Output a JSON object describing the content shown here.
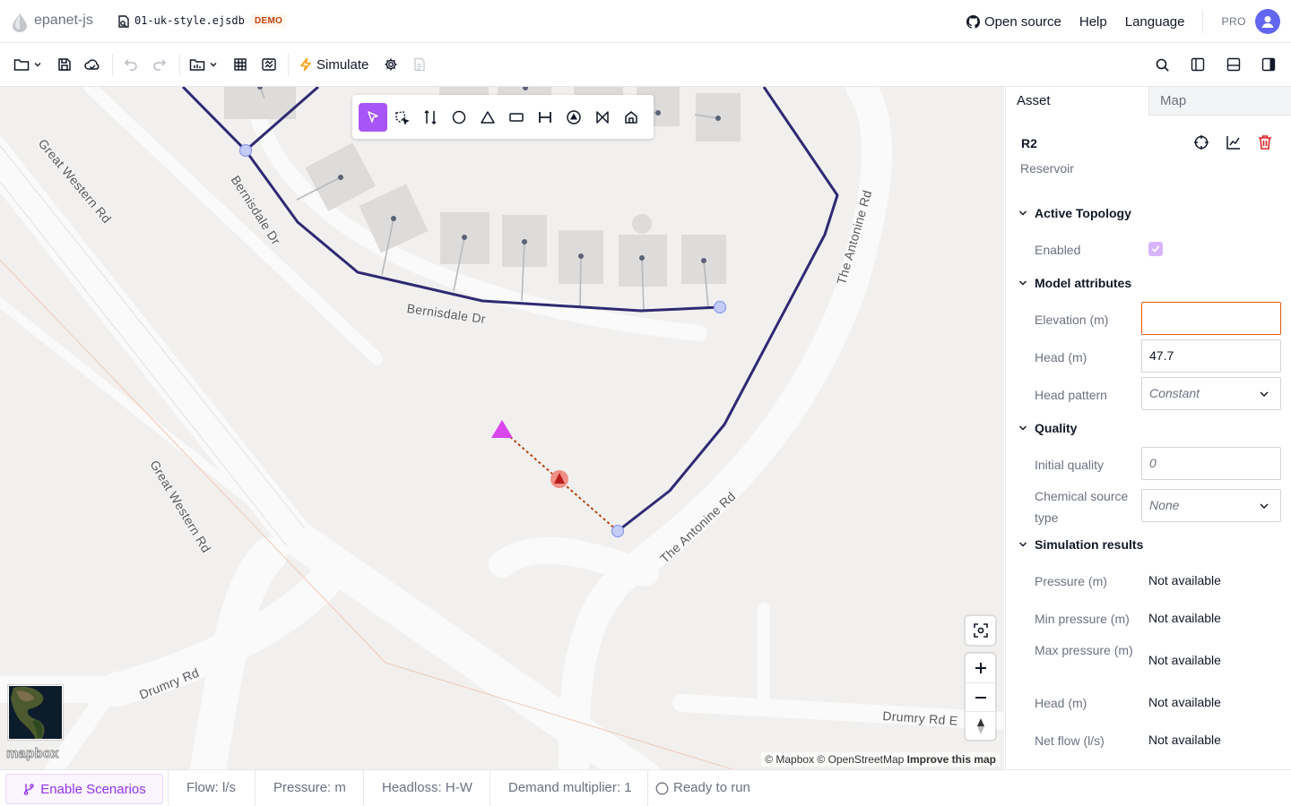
{
  "header": {
    "app_name": "epanet-js",
    "file_name": "01-uk-style.ejsdb",
    "badge": "DEMO",
    "links": [
      "Open source",
      "Help",
      "Language"
    ],
    "plan": "PRO"
  },
  "toolbar": {
    "simulate_label": "Simulate",
    "icons": [
      "folder-icon",
      "save-icon",
      "save-cloud-icon",
      "undo-icon",
      "redo-icon",
      "import-icon",
      "table-icon",
      "compare-icon",
      "simulate-icon",
      "settings-icon",
      "report-icon",
      "search-icon",
      "left-panel-icon",
      "bottom-panel-icon",
      "right-panel-icon"
    ]
  },
  "map": {
    "road_labels": [
      "Great Western Rd",
      "Bernisdale Dr",
      "Bernisdale Dr",
      "The Antonine Rd",
      "The Antonine Rd",
      "Great Western Rd",
      "Drumry Rd",
      "Drumry Rd E"
    ],
    "attribution": "© Mapbox © OpenStreetMap",
    "improve": "Improve this map",
    "mapbox_logo": "mapbox",
    "draw_tools": [
      "select-icon",
      "area-select-icon",
      "connect-icon",
      "junction-icon",
      "reservoir-icon",
      "tank-icon",
      "pipe-icon",
      "pump-icon",
      "valve-icon",
      "customer-icon"
    ]
  },
  "panel": {
    "tabs": [
      "Asset",
      "Map"
    ],
    "asset_id": "R2",
    "asset_type": "Reservoir",
    "sections": {
      "topology": "Active Topology",
      "model": "Model attributes",
      "quality": "Quality",
      "results": "Simulation results"
    },
    "topology": {
      "enabled_label": "Enabled",
      "enabled": true
    },
    "model": {
      "elevation_label": "Elevation (m)",
      "elevation_value": "",
      "head_label": "Head (m)",
      "head_value": "47.7",
      "pattern_label": "Head pattern",
      "pattern_value": "Constant"
    },
    "quality": {
      "initial_label": "Initial quality",
      "initial_placeholder": "0",
      "source_label": "Chemical source type",
      "source_value": "None"
    },
    "results": [
      {
        "label": "Pressure (m)",
        "value": "Not available"
      },
      {
        "label": "Min pressure (m)",
        "value": "Not available"
      },
      {
        "label": "Max pressure (m)",
        "value": "Not available"
      },
      {
        "label": "Head (m)",
        "value": "Not available"
      },
      {
        "label": "Net flow (l/s)",
        "value": "Not available"
      }
    ]
  },
  "footer": {
    "scenarios_button": "Enable Scenarios",
    "flow": "Flow: l/s",
    "pressure": "Pressure: m",
    "headloss": "Headloss: H-W",
    "demand": "Demand multiplier: 1",
    "status": "Ready to run"
  },
  "colors": {
    "accent": "#a855f7",
    "pipe": "#2e2a72",
    "danger": "#dc2626",
    "error_border": "#ea580c"
  }
}
